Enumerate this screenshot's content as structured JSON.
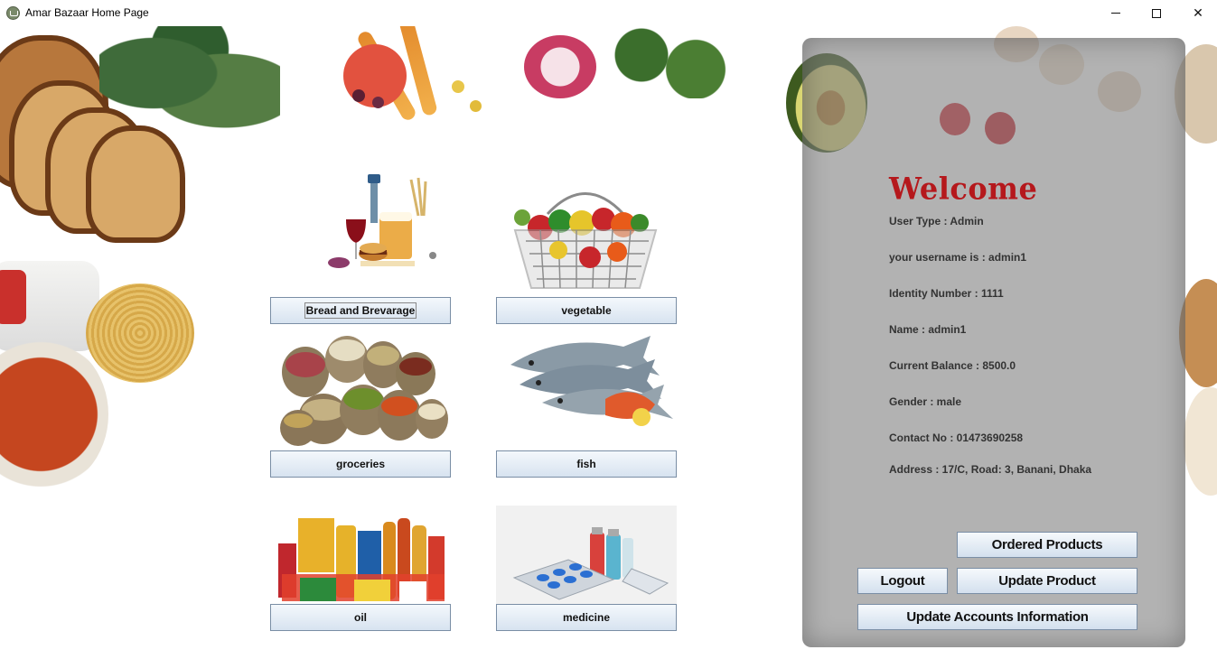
{
  "window": {
    "title": "Amar Bazaar Home Page",
    "controls": {
      "minimize": "minimize",
      "maximize": "maximize",
      "close": "close"
    }
  },
  "categories": [
    {
      "label": "Bread and Brevarage",
      "image": "bread-beverage-image"
    },
    {
      "label": "vegetable",
      "image": "vegetable-basket-image"
    },
    {
      "label": "groceries",
      "image": "groceries-sacks-image"
    },
    {
      "label": "fish",
      "image": "fish-image"
    },
    {
      "label": "oil",
      "image": "oil-packages-image"
    },
    {
      "label": "medicine",
      "image": "medicine-image"
    }
  ],
  "panel": {
    "welcome": "Welcome",
    "user_type": "User Type : Admin",
    "username": "your username is : admin1",
    "identity": "Identity Number : 1111",
    "name": "Name : admin1",
    "balance": "Current Balance : 8500.0",
    "gender": "Gender : male",
    "contact": "Contact No : 01473690258",
    "address": "Address : 17/C, Road: 3, Banani, Dhaka",
    "buttons": {
      "ordered_products": "Ordered Products",
      "logout": "Logout",
      "update_product": "Update Product",
      "update_accounts": "Update Accounts Information"
    }
  },
  "colors": {
    "welcome": "#b5181c",
    "panel_bg": "#828282",
    "button_top": "#f6f9fc",
    "button_bottom": "#d3e0ee"
  }
}
